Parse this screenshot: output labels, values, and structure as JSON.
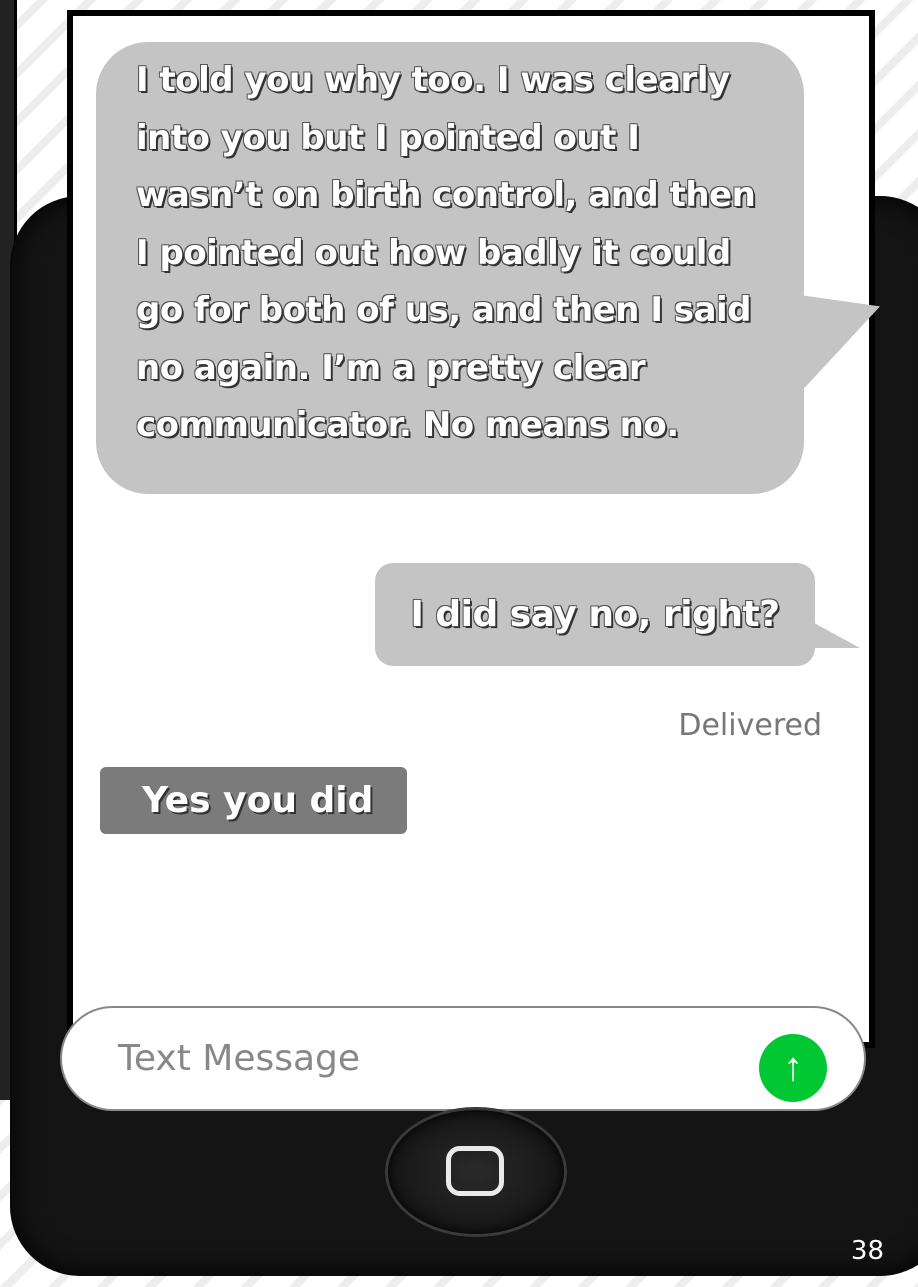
{
  "conversation": {
    "messages": [
      {
        "text": "I told you why too. I was clearly into you but I pointed out I wasn’t on birth control, and then I pointed out how badly it could go for both of us, and then I said no again. I’m a pretty clear communicator. No means no."
      },
      {
        "text": "I did say no, right?"
      }
    ],
    "status": "Delivered",
    "reply": "Yes you did"
  },
  "composer": {
    "placeholder": "Text Message",
    "send_icon": "send-arrow-icon",
    "send_color": "#00c832"
  },
  "page_number": "38"
}
